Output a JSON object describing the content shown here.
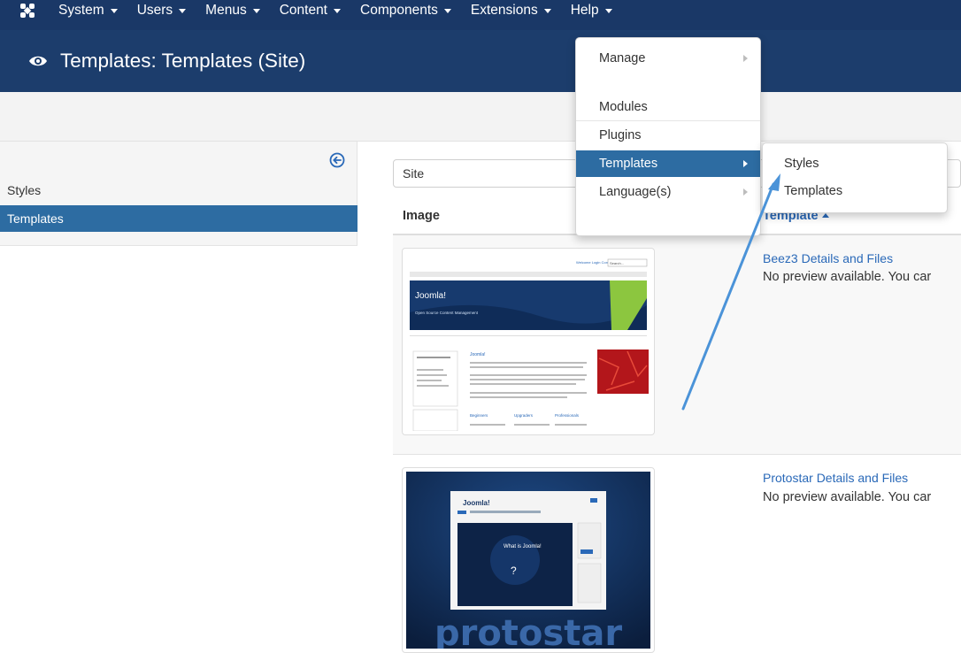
{
  "topnav": {
    "items": [
      "System",
      "Users",
      "Menus",
      "Content",
      "Components",
      "Extensions",
      "Help"
    ]
  },
  "header": {
    "title": "Templates: Templates (Site)"
  },
  "sidebar": {
    "items": [
      "Styles",
      "Templates"
    ],
    "active": "Templates"
  },
  "filter": {
    "value": "Site"
  },
  "table": {
    "col_image": "Image",
    "col_template": "Template",
    "rows": [
      {
        "name": "Beez3 Details and Files",
        "desc": "No preview available. You car"
      },
      {
        "name": "Protostar Details and Files",
        "desc": "No preview available. You car"
      }
    ]
  },
  "thumb1": {
    "top_links": [
      "Welcome",
      "Login",
      "Contact",
      "Search..."
    ],
    "brand": "Joomla!",
    "tagline": "Open Source Content Management",
    "article_heading": "Joomla!",
    "col_labels": [
      "Beginners",
      "Upgraders",
      "Professionals"
    ]
  },
  "thumb2": {
    "brand": "Joomla!",
    "hero_text": "What is Joomla!",
    "wordmark": "protostar"
  },
  "extensions_menu": {
    "items": [
      "Manage",
      "Modules",
      "Plugins",
      "Templates",
      "Language(s)"
    ],
    "highlighted": "Templates"
  },
  "templates_submenu": {
    "items": [
      "Styles",
      "Templates"
    ]
  },
  "colors": {
    "nav_bg": "#1a3867",
    "header_bg": "#1c3d6c",
    "accent": "#2d6ca2",
    "link": "#2a69b8",
    "arrow": "#4b93d8"
  }
}
